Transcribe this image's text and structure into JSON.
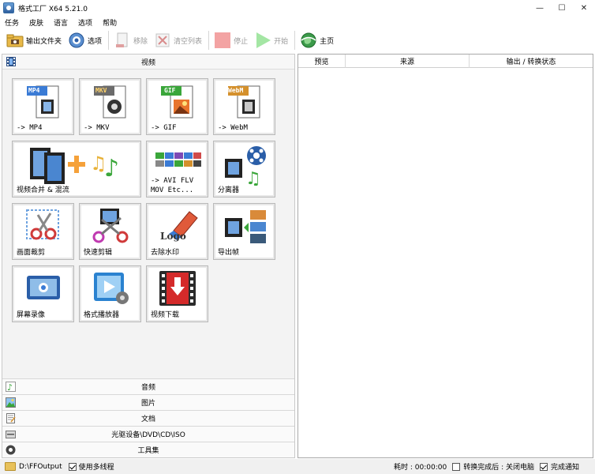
{
  "window": {
    "title": "格式工厂 X64 5.21.0",
    "controls": [
      "—",
      "☐",
      "✕"
    ]
  },
  "menu": [
    "任务",
    "皮肤",
    "语言",
    "选项",
    "帮助"
  ],
  "toolbar": {
    "output_folder": "输出文件夹",
    "options": "选项",
    "remove": "移除",
    "clear_list": "清空列表",
    "stop": "停止",
    "start": "开始",
    "home": "主页"
  },
  "left": {
    "video_header": "视频",
    "tiles": [
      {
        "badge": "MP4",
        "label": "-> MP4"
      },
      {
        "badge": "MKV",
        "label": "-> MKV"
      },
      {
        "badge": "GIF",
        "label": "-> GIF"
      },
      {
        "badge": "WebM",
        "label": "-> WebM"
      },
      {
        "label": "视频合并 & 混流"
      },
      {
        "label": "-> AVI FLV",
        "label2": "MOV Etc..."
      },
      {
        "label": "分离器"
      },
      {
        "label": "画面裁剪"
      },
      {
        "label": "快速剪辑"
      },
      {
        "label": "去除水印",
        "art_text": "Logo"
      },
      {
        "label": "导出帧"
      },
      {
        "label": "屏幕录像"
      },
      {
        "label": "格式播放器"
      },
      {
        "label": "视频下载"
      }
    ],
    "categories": [
      "音频",
      "图片",
      "文档",
      "光驱设备\\DVD\\CD\\ISO",
      "工具集"
    ]
  },
  "right": {
    "columns": [
      "预览",
      "来源",
      "输出 / 转换状态"
    ]
  },
  "status": {
    "path": "D:\\FFOutput",
    "multithread": "使用多线程",
    "elapsed": "耗时 : 00:00:00",
    "after_done": "转换完成后 : 关闭电脑",
    "notify": "完成通知"
  },
  "colors": {
    "mp4": "#3a7bd5",
    "mkv": "#6b6b6b",
    "gif": "#3aa63a",
    "webm": "#d4902c",
    "stop": "#f08a8a",
    "start": "#9fe39f"
  }
}
